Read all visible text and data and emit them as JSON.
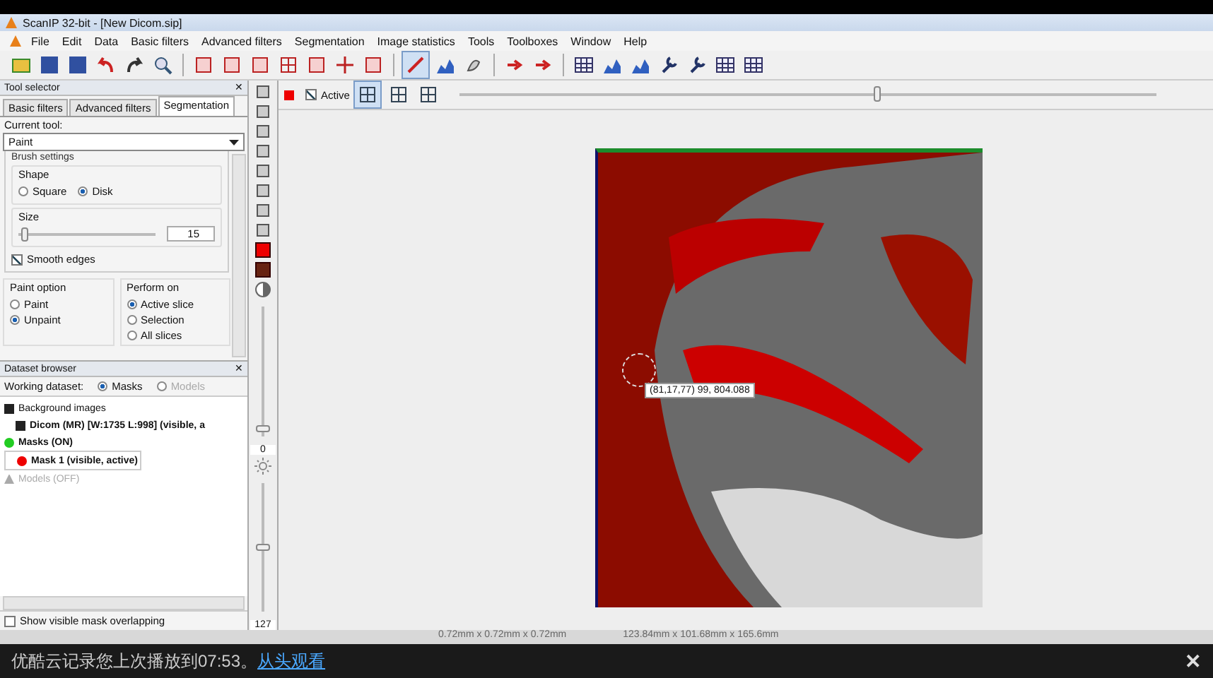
{
  "window": {
    "title": "ScanIP 32-bit - [New Dicom.sip]"
  },
  "menu": [
    "File",
    "Edit",
    "Data",
    "Basic filters",
    "Advanced filters",
    "Segmentation",
    "Image statistics",
    "Tools",
    "Toolboxes",
    "Window",
    "Help"
  ],
  "tool_selector": {
    "title": "Tool selector",
    "tabs": [
      {
        "label": "Basic filters",
        "selected": false
      },
      {
        "label": "Advanced filters",
        "selected": false
      },
      {
        "label": "Segmentation",
        "selected": true
      }
    ],
    "current_tool_label": "Current tool:",
    "current_tool": "Paint",
    "section_title": "Brush settings",
    "shape_title": "Shape",
    "shapes": [
      {
        "label": "Square",
        "selected": false
      },
      {
        "label": "Disk",
        "selected": true
      }
    ],
    "size_title": "Size",
    "size": {
      "level": 0.05,
      "value": "15"
    },
    "smooth_edges": {
      "label": "Smooth edges",
      "checked": true
    },
    "paint_option_title": "Paint option",
    "paint_options": [
      {
        "label": "Paint",
        "selected": false
      },
      {
        "label": "Unpaint",
        "selected": true
      }
    ],
    "perform_on_title": "Perform on",
    "perform_on": [
      {
        "label": "Active slice",
        "selected": true
      },
      {
        "label": "Selection",
        "selected": false
      },
      {
        "label": "All slices",
        "selected": false
      }
    ]
  },
  "dataset_browser": {
    "title": "Dataset browser",
    "working_label": "Working dataset:",
    "working": [
      {
        "label": "Masks",
        "selected": true
      },
      {
        "label": "Models",
        "selected": false
      }
    ],
    "tree": [
      {
        "label": "Background images",
        "kind": "images",
        "disabled": false,
        "children": [
          {
            "label": "Dicom  (MR) [W:1735 L:998] (visible, a",
            "kind": "image",
            "disabled": false,
            "bold": true
          }
        ]
      },
      {
        "label": "Masks (ON)",
        "kind": "masks",
        "disabled": false,
        "bold": true,
        "children": [
          {
            "label": "Mask 1 (visible, active)",
            "kind": "mask",
            "disabled": false,
            "bold": true,
            "selected": true
          }
        ]
      },
      {
        "label": "Models (OFF)",
        "kind": "models",
        "disabled": true
      }
    ],
    "overlap": {
      "label": "Show visible mask overlapping",
      "checked": false
    }
  },
  "side_controls": {
    "contrast": {
      "level": 0.05,
      "value": "0"
    },
    "brightness": {
      "level": 0.5,
      "value": "127"
    }
  },
  "viewer": {
    "active": {
      "label": "Active",
      "checked": true
    },
    "slice": {
      "level": 0.6
    },
    "tooltip": "(81,17,77) 99, 804.088"
  },
  "status_bar": [
    "0.72mm x 0.72mm x 0.72mm",
    "123.84mm x 101.68mm x 165.6mm"
  ],
  "resume_notice": {
    "text": "优酷云记录您上次播放到07:53。",
    "link": "从头观看",
    "close": "✕"
  }
}
